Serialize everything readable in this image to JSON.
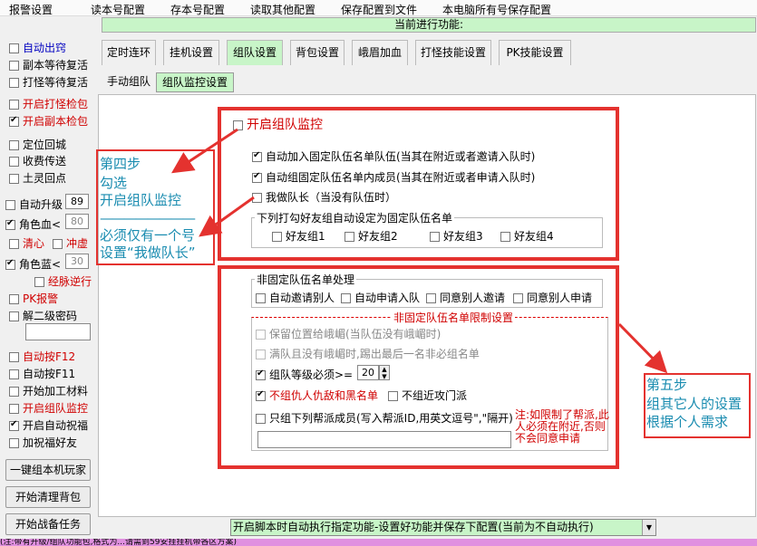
{
  "menu": [
    "报警设置",
    "读本号配置",
    "存本号配置",
    "读取其他配置",
    "保存配置到文件",
    "本电脑所有号保存配置"
  ],
  "current_function": "当前进行功能:",
  "left": {
    "checks": [
      {
        "label": "自动出窍",
        "checked": false,
        "color": "blue"
      },
      {
        "label": "副本等待复活",
        "checked": false,
        "color": ""
      },
      {
        "label": "打怪等待复活",
        "checked": false,
        "color": ""
      },
      {
        "label": "开启打怪检包",
        "checked": false,
        "color": "red"
      },
      {
        "label": "开启副本检包",
        "checked": true,
        "color": "red"
      },
      {
        "label": "定位回城",
        "checked": false,
        "color": ""
      },
      {
        "label": "收费传送",
        "checked": false,
        "color": ""
      },
      {
        "label": "土灵回点",
        "checked": false,
        "color": ""
      }
    ],
    "auto_level_label": "自动升级",
    "auto_level_value": "89",
    "hp_label": "角色血<",
    "hp_value": "80",
    "qingxin": "清心",
    "chongxu": "冲虚",
    "mp_label": "角色蓝<",
    "mp_value": "30",
    "jingmai": "经脉逆行",
    "pk_alarm": "PK报警",
    "unlock2": "解二级密码",
    "checks2": [
      {
        "label": "自动按F12",
        "checked": false,
        "color": "red"
      },
      {
        "label": "自动按F11",
        "checked": false,
        "color": ""
      },
      {
        "label": "开始加工材料",
        "checked": false,
        "color": ""
      },
      {
        "label": "开启组队监控",
        "checked": false,
        "color": "red"
      },
      {
        "label": "开启自动祝福",
        "checked": true,
        "color": ""
      },
      {
        "label": "加祝福好友",
        "checked": false,
        "color": ""
      }
    ],
    "buttons": [
      "一键组本机玩家",
      "开始清理背包",
      "开始战备任务"
    ]
  },
  "tabs": [
    "定时连环",
    "挂机设置",
    "组队设置",
    "背包设置",
    "峨眉加血",
    "打怪技能设置",
    "PK技能设置"
  ],
  "subtabs": [
    "手动组队",
    "组队监控设置"
  ],
  "team": {
    "enable_monitor": "开启组队监控",
    "auto_join_fixed": "自动加入固定队伍名单队伍(当其在附近或者邀请入队时)",
    "auto_team_fixed": "自动组固定队伍名单内成员(当其在附近或者申请入队时)",
    "i_am_leader": "我做队长（当没有队伍时）",
    "friend_group_title": "下列打勾好友组自动设定为固定队伍名单",
    "friend_groups": [
      "好友组1",
      "好友组2",
      "好友组3",
      "好友组4"
    ]
  },
  "nonfixed": {
    "title": "非固定队伍名单处理",
    "options": [
      "自动邀请别人",
      "自动申请入队",
      "同意别人邀请",
      "同意别人申请"
    ],
    "limits_title": "非固定队伍名单限制设置",
    "keep_emei": "保留位置给峨嵋(当队伍没有峨嵋时)",
    "kick_non": "满队且没有峨嵋时,踢出最后一名非必组名单",
    "level_req": "组队等级必须>=",
    "level_value": "20",
    "no_enemy": "不组仇人仇敌和黑名单",
    "no_close_attack": "不组近攻门派",
    "only_guild": "只组下列帮派成员(写入帮派ID,用英文逗号\",\"隔开)",
    "note": "注:如限制了帮派,此人必须在附近,否则不会同意申请"
  },
  "annotations": {
    "step4": [
      "第四步",
      "勾选",
      "开启组队监控"
    ],
    "dashes": "————————",
    "step4b": [
      "必须仅有一个号",
      "设置“我做队长”"
    ],
    "step5": [
      "第五步",
      "组其它人的设置",
      "根据个人需求"
    ]
  },
  "status": "开启脚本时自动执行指定功能-设置好功能并保存下配置(当前为不自动执行)",
  "ticker": "(注:带有升级/组队功能包,格式为...请需到59安挂挂机带各区方案)",
  "colors": {
    "accent_green": "#c8f5c8",
    "annotation_red": "#e4322f",
    "annotation_cyan": "#1a8cb0"
  }
}
